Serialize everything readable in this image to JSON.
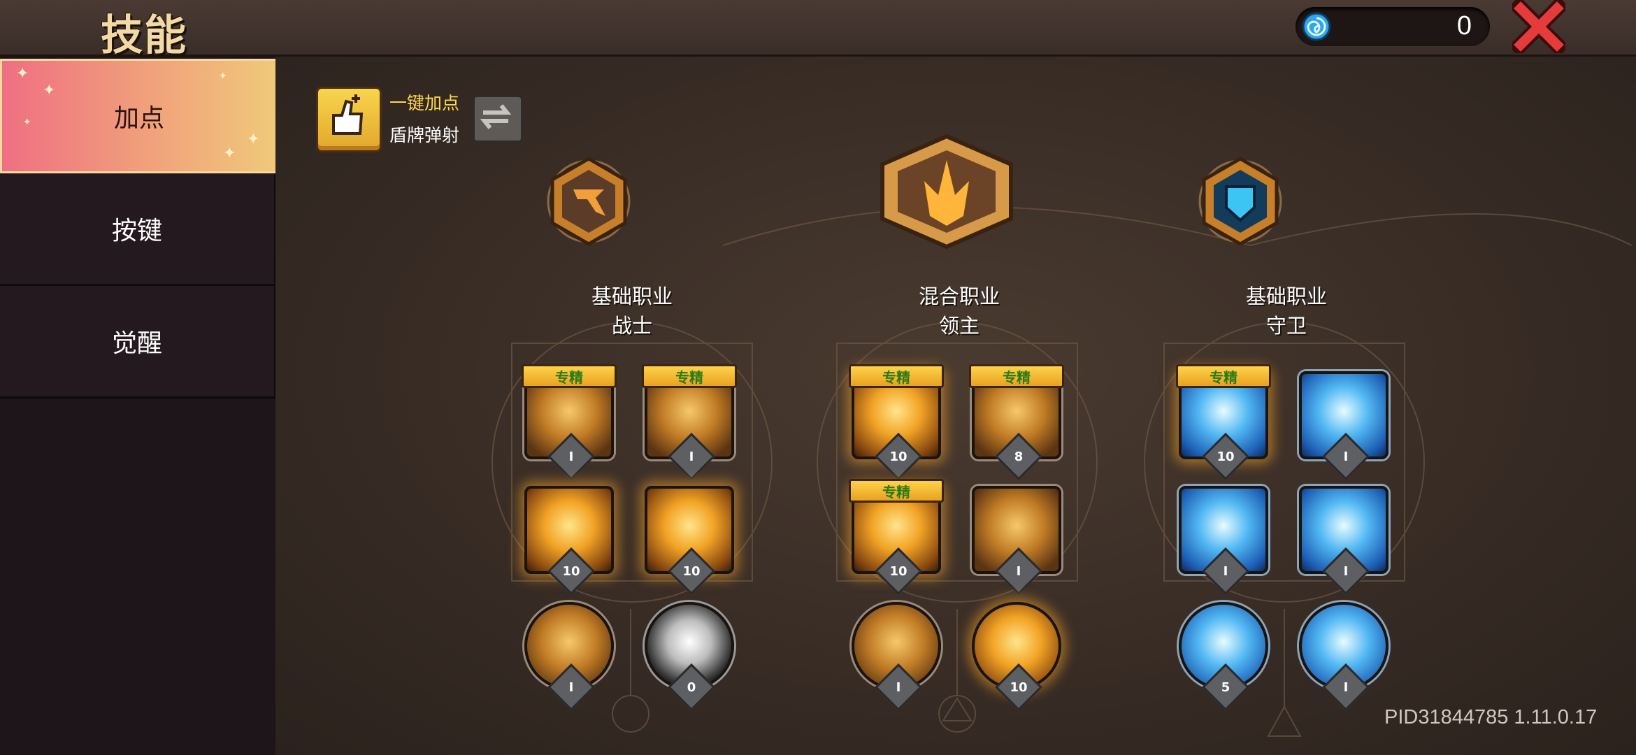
{
  "header": {
    "title": "技能",
    "currency_value": "0"
  },
  "sidebar": {
    "tabs": [
      {
        "label": "加点",
        "active": true
      },
      {
        "label": "按键",
        "active": false
      },
      {
        "label": "觉醒",
        "active": false
      }
    ]
  },
  "auto_assign": {
    "label": "一键加点",
    "current_skill": "盾牌弹射"
  },
  "classes": [
    {
      "type": "基础职业",
      "name": "战士"
    },
    {
      "type": "混合职业",
      "name": "领主"
    },
    {
      "type": "基础职业",
      "name": "守卫"
    }
  ],
  "mastery_tag": "专精",
  "skills": {
    "warrior": [
      "Ⅰ",
      "Ⅰ",
      "10",
      "10",
      "Ⅰ",
      "0"
    ],
    "lord": [
      "10",
      "8",
      "10",
      "Ⅰ",
      "Ⅰ",
      "10"
    ],
    "guard": [
      "10",
      "Ⅰ",
      "Ⅰ",
      "Ⅰ",
      "5",
      "Ⅰ"
    ]
  },
  "version": "PID31844785 1.11.0.17",
  "colors": {
    "accent_gold": "#f2a325",
    "accent_blue": "#52b8f3",
    "close_red": "#e63b3b"
  }
}
